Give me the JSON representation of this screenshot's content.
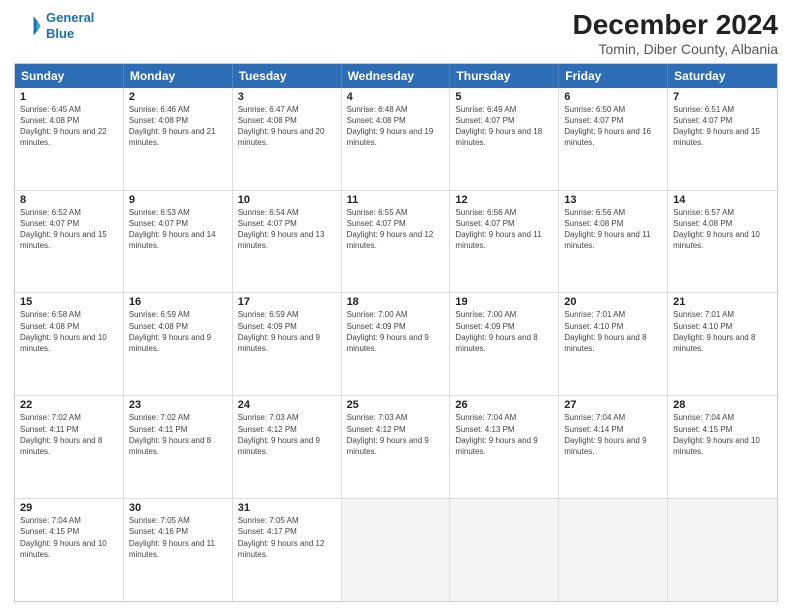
{
  "header": {
    "logo_line1": "General",
    "logo_line2": "Blue",
    "title": "December 2024",
    "subtitle": "Tomin, Diber County, Albania"
  },
  "calendar": {
    "days_of_week": [
      "Sunday",
      "Monday",
      "Tuesday",
      "Wednesday",
      "Thursday",
      "Friday",
      "Saturday"
    ],
    "rows": [
      [
        {
          "day": "1",
          "sunrise": "6:45 AM",
          "sunset": "4:08 PM",
          "daylight": "9 hours and 22 minutes."
        },
        {
          "day": "2",
          "sunrise": "6:46 AM",
          "sunset": "4:08 PM",
          "daylight": "9 hours and 21 minutes."
        },
        {
          "day": "3",
          "sunrise": "6:47 AM",
          "sunset": "4:08 PM",
          "daylight": "9 hours and 20 minutes."
        },
        {
          "day": "4",
          "sunrise": "6:48 AM",
          "sunset": "4:08 PM",
          "daylight": "9 hours and 19 minutes."
        },
        {
          "day": "5",
          "sunrise": "6:49 AM",
          "sunset": "4:07 PM",
          "daylight": "9 hours and 18 minutes."
        },
        {
          "day": "6",
          "sunrise": "6:50 AM",
          "sunset": "4:07 PM",
          "daylight": "9 hours and 16 minutes."
        },
        {
          "day": "7",
          "sunrise": "6:51 AM",
          "sunset": "4:07 PM",
          "daylight": "9 hours and 15 minutes."
        }
      ],
      [
        {
          "day": "8",
          "sunrise": "6:52 AM",
          "sunset": "4:07 PM",
          "daylight": "9 hours and 15 minutes."
        },
        {
          "day": "9",
          "sunrise": "6:53 AM",
          "sunset": "4:07 PM",
          "daylight": "9 hours and 14 minutes."
        },
        {
          "day": "10",
          "sunrise": "6:54 AM",
          "sunset": "4:07 PM",
          "daylight": "9 hours and 13 minutes."
        },
        {
          "day": "11",
          "sunrise": "6:55 AM",
          "sunset": "4:07 PM",
          "daylight": "9 hours and 12 minutes."
        },
        {
          "day": "12",
          "sunrise": "6:56 AM",
          "sunset": "4:07 PM",
          "daylight": "9 hours and 11 minutes."
        },
        {
          "day": "13",
          "sunrise": "6:56 AM",
          "sunset": "4:08 PM",
          "daylight": "9 hours and 11 minutes."
        },
        {
          "day": "14",
          "sunrise": "6:57 AM",
          "sunset": "4:08 PM",
          "daylight": "9 hours and 10 minutes."
        }
      ],
      [
        {
          "day": "15",
          "sunrise": "6:58 AM",
          "sunset": "4:08 PM",
          "daylight": "9 hours and 10 minutes."
        },
        {
          "day": "16",
          "sunrise": "6:59 AM",
          "sunset": "4:08 PM",
          "daylight": "9 hours and 9 minutes."
        },
        {
          "day": "17",
          "sunrise": "6:59 AM",
          "sunset": "4:09 PM",
          "daylight": "9 hours and 9 minutes."
        },
        {
          "day": "18",
          "sunrise": "7:00 AM",
          "sunset": "4:09 PM",
          "daylight": "9 hours and 9 minutes."
        },
        {
          "day": "19",
          "sunrise": "7:00 AM",
          "sunset": "4:09 PM",
          "daylight": "9 hours and 8 minutes."
        },
        {
          "day": "20",
          "sunrise": "7:01 AM",
          "sunset": "4:10 PM",
          "daylight": "9 hours and 8 minutes."
        },
        {
          "day": "21",
          "sunrise": "7:01 AM",
          "sunset": "4:10 PM",
          "daylight": "9 hours and 8 minutes."
        }
      ],
      [
        {
          "day": "22",
          "sunrise": "7:02 AM",
          "sunset": "4:11 PM",
          "daylight": "9 hours and 8 minutes."
        },
        {
          "day": "23",
          "sunrise": "7:02 AM",
          "sunset": "4:11 PM",
          "daylight": "9 hours and 8 minutes."
        },
        {
          "day": "24",
          "sunrise": "7:03 AM",
          "sunset": "4:12 PM",
          "daylight": "9 hours and 9 minutes."
        },
        {
          "day": "25",
          "sunrise": "7:03 AM",
          "sunset": "4:12 PM",
          "daylight": "9 hours and 9 minutes."
        },
        {
          "day": "26",
          "sunrise": "7:04 AM",
          "sunset": "4:13 PM",
          "daylight": "9 hours and 9 minutes."
        },
        {
          "day": "27",
          "sunrise": "7:04 AM",
          "sunset": "4:14 PM",
          "daylight": "9 hours and 9 minutes."
        },
        {
          "day": "28",
          "sunrise": "7:04 AM",
          "sunset": "4:15 PM",
          "daylight": "9 hours and 10 minutes."
        }
      ],
      [
        {
          "day": "29",
          "sunrise": "7:04 AM",
          "sunset": "4:15 PM",
          "daylight": "9 hours and 10 minutes."
        },
        {
          "day": "30",
          "sunrise": "7:05 AM",
          "sunset": "4:16 PM",
          "daylight": "9 hours and 11 minutes."
        },
        {
          "day": "31",
          "sunrise": "7:05 AM",
          "sunset": "4:17 PM",
          "daylight": "9 hours and 12 minutes."
        },
        null,
        null,
        null,
        null
      ]
    ],
    "labels": {
      "sunrise": "Sunrise:",
      "sunset": "Sunset:",
      "daylight": "Daylight:"
    }
  }
}
